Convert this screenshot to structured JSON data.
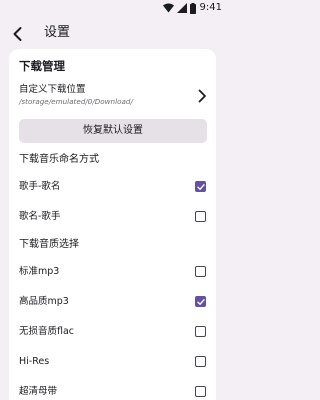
{
  "status_bar": {
    "time": "9:41",
    "icons": [
      "wifi-icon",
      "signal-icon",
      "battery-icon"
    ]
  },
  "app_bar": {
    "title": "设置",
    "back_icon": "arrow-back-icon"
  },
  "download": {
    "section_title": "下载管理",
    "path_label": "自定义下载位置",
    "path_value": "/storage/emulated/0/Download/",
    "path_icon": "chevron-right-icon",
    "restore_label": "恢复默认设置",
    "naming": {
      "label": "下载音乐命名方式",
      "options": [
        {
          "label": "歌手-歌名",
          "checked": true
        },
        {
          "label": "歌名-歌手",
          "checked": false
        }
      ]
    },
    "quality": {
      "label": "下载音质选择",
      "options": [
        {
          "label": "标准mp3",
          "checked": false
        },
        {
          "label": "高品质mp3",
          "checked": true
        },
        {
          "label": "无损音质flac",
          "checked": false
        },
        {
          "label": "Hi-Res",
          "checked": false
        },
        {
          "label": "超清母带",
          "checked": false
        }
      ]
    }
  },
  "colors": {
    "background": "#f3eff4",
    "card": "#ffffff",
    "accent": "#6650a4",
    "button": "#e6e1e6"
  }
}
